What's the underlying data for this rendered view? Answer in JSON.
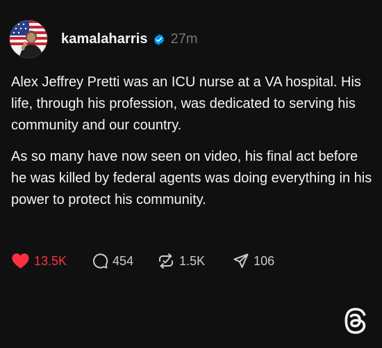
{
  "post": {
    "username": "kamalaharris",
    "verified": true,
    "time": "27m",
    "paragraphs": [
      "Alex Jeffrey Pretti was an ICU nurse at a VA hospital. His life, through his profession, was dedicated to serving his community and our country.",
      "As so many have now seen on video, his final act before he was killed by federal agents was doing everything in his power to protect his community."
    ],
    "actions": {
      "likes": "13.5K",
      "replies": "454",
      "reposts": "1.5K",
      "shares": "106"
    }
  },
  "colors": {
    "background": "#101010",
    "text": "#f3f5f7",
    "muted": "#777777",
    "like": "#ff3040",
    "verified": "#0095f6"
  },
  "icons": {
    "verified": "verified-badge-icon",
    "like": "heart-icon",
    "reply": "comment-icon",
    "repost": "repost-icon",
    "share": "send-icon",
    "brand": "threads-logo-icon"
  }
}
